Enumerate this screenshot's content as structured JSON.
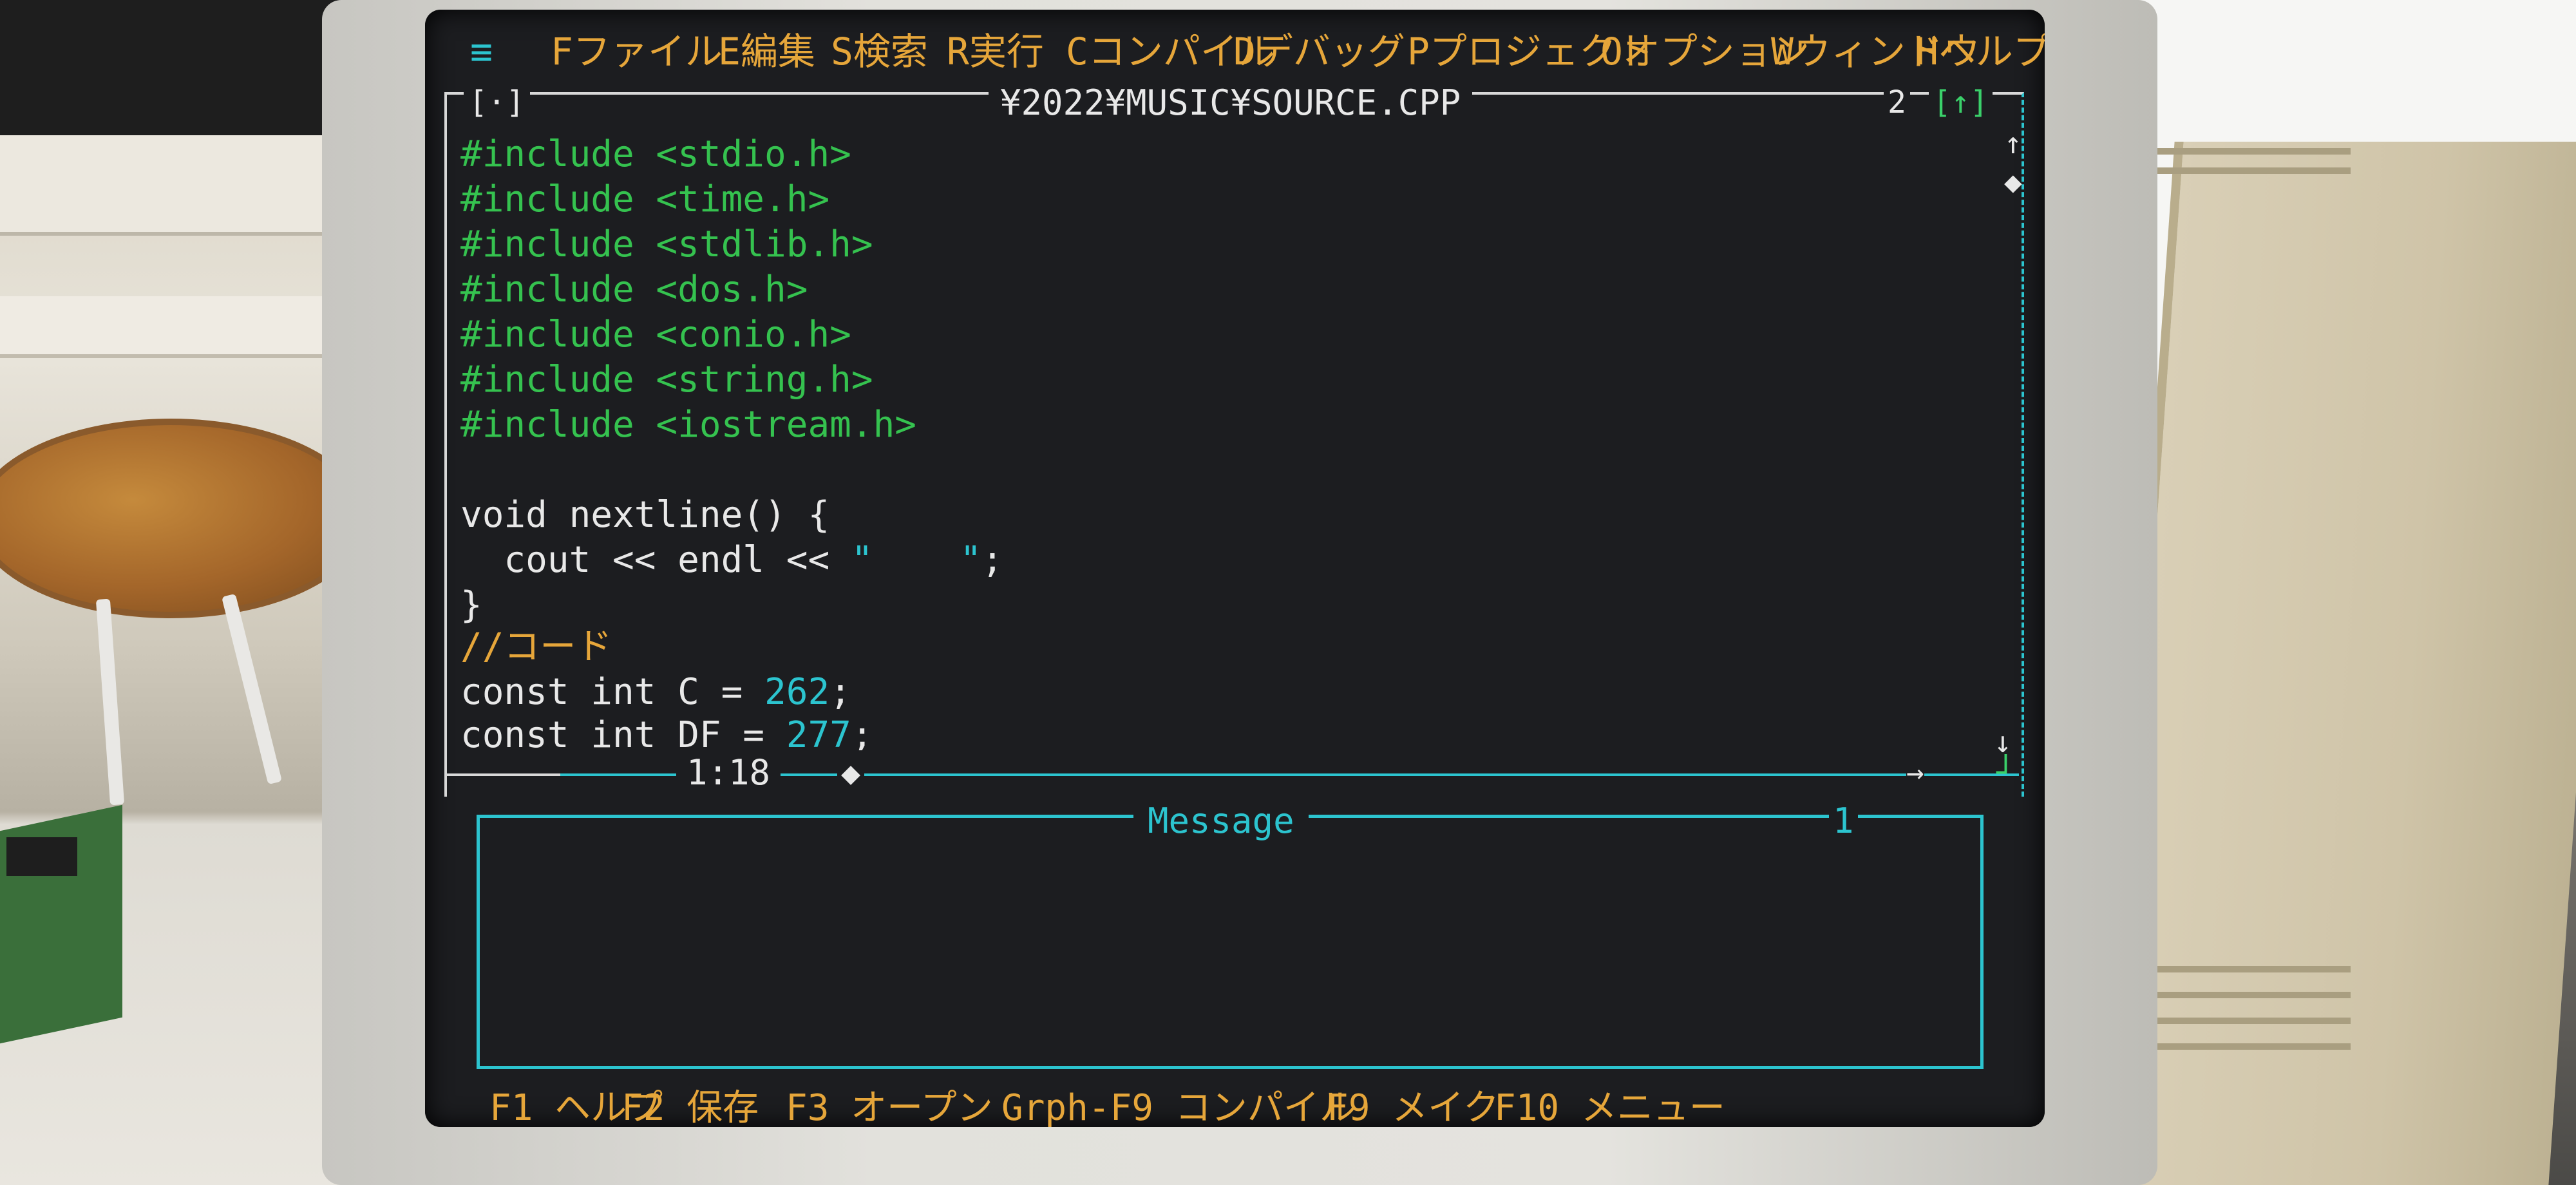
{
  "ide": {
    "menubar": {
      "system_icon": "≡",
      "items": [
        {
          "label": "Fファイル"
        },
        {
          "label": "E編集"
        },
        {
          "label": "S検索"
        },
        {
          "label": "R実行"
        },
        {
          "label": "Cコンパイル"
        },
        {
          "label": "Dデバッグ"
        },
        {
          "label": "Pプロジェクト"
        },
        {
          "label": "Oオプション"
        },
        {
          "label": "Wウィンドウ"
        },
        {
          "label": "Hヘルプ"
        }
      ]
    },
    "editor": {
      "close_box": "[·]",
      "title": "¥2022¥MUSIC¥SOURCE.CPP",
      "window_number": "2",
      "zoom_box": "[↑]",
      "scroll_up": "↑",
      "scroll_thumb": "◆",
      "scroll_down": "↓",
      "cursor_position": "1:18",
      "hscroll_thumb": "◆",
      "hscroll_right": "→",
      "resize_corner": "┘",
      "includes": [
        "#include <stdio.h>",
        "#include <time.h>",
        "#include <stdlib.h>",
        "#include <dos.h>",
        "#include <conio.h>",
        "#include <string.h>",
        "#include <iostream.h>"
      ],
      "func_decl": "void nextline() {",
      "cout_part": "  cout << endl << ",
      "cout_string": "\"    \"",
      "cout_end": ";",
      "close_brace": "}",
      "comment": "//コード",
      "const_c_prefix": "const int C = ",
      "const_c_value": "262",
      "const_c_suffix": ";",
      "const_df_prefix": "const int DF = ",
      "const_df_value": "277",
      "const_df_suffix": ";"
    },
    "message_window": {
      "title": "Message",
      "window_number": "1"
    },
    "function_keys": [
      {
        "key": "F1",
        "label": "ヘルプ"
      },
      {
        "key": "F2",
        "label": "保存"
      },
      {
        "key": "F3",
        "label": "オープン"
      },
      {
        "key": "Grph-F9",
        "label": "コンパイル"
      },
      {
        "key": "F9",
        "label": "メイク"
      },
      {
        "key": "F10",
        "label": "メニュー"
      }
    ]
  },
  "colors": {
    "accent_yellow": "#e6a63a",
    "accent_cyan": "#2cc4cf",
    "include_green": "#35c24f",
    "screen_bg": "#1c1d20"
  }
}
